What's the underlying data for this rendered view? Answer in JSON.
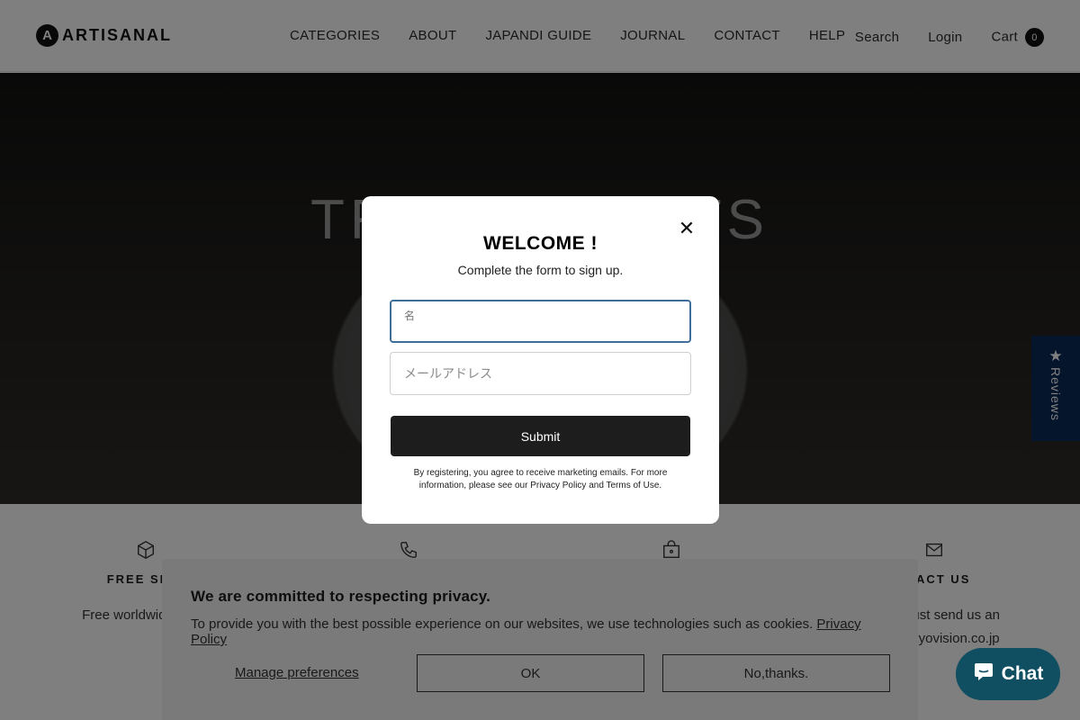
{
  "header": {
    "logo_text": "ARTISANAL",
    "logo_mark": "A",
    "nav": [
      "CATEGORIES",
      "ABOUT",
      "JAPANDI GUIDE",
      "JOURNAL",
      "CONTACT",
      "HELP"
    ],
    "search_label": "Search",
    "login_label": "Login",
    "cart_label": "Cart",
    "cart_count": "0"
  },
  "hero": {
    "title": "TR              TS"
  },
  "reviews_tab": {
    "label": "Reviews",
    "icon": "star-icon"
  },
  "features": [
    {
      "icon": "box-icon",
      "title": "FREE SHIP",
      "text": "Free worldwide shipp"
    },
    {
      "icon": "phone-icon",
      "title": "",
      "text": ""
    },
    {
      "icon": "bag-lock-icon",
      "title": "",
      "text": ""
    },
    {
      "icon": "mail-icon",
      "title": "NTACT US",
      "text": "t us ? Just send us an",
      "text2": "nal@tokyovision.co.jp"
    }
  ],
  "cookie": {
    "title": "We are committed to respecting privacy.",
    "text": "To provide you with the best possible experience on our websites, we use technologies such as cookies.",
    "privacy_link": "Privacy Policy",
    "manage_label": "Manage preferences",
    "ok_label": "OK",
    "no_label": "No,thanks."
  },
  "modal": {
    "title": "WELCOME !",
    "subtitle": "Complete the form to sign up.",
    "name_label": "名",
    "email_placeholder": "メールアドレス",
    "submit_label": "Submit",
    "legal": "By registering, you agree to receive marketing emails. For more information, please see our Privacy Policy and Terms of Use.",
    "close_icon": "close-icon"
  },
  "chat": {
    "label": "Chat",
    "icon": "chat-bubble-icon"
  }
}
